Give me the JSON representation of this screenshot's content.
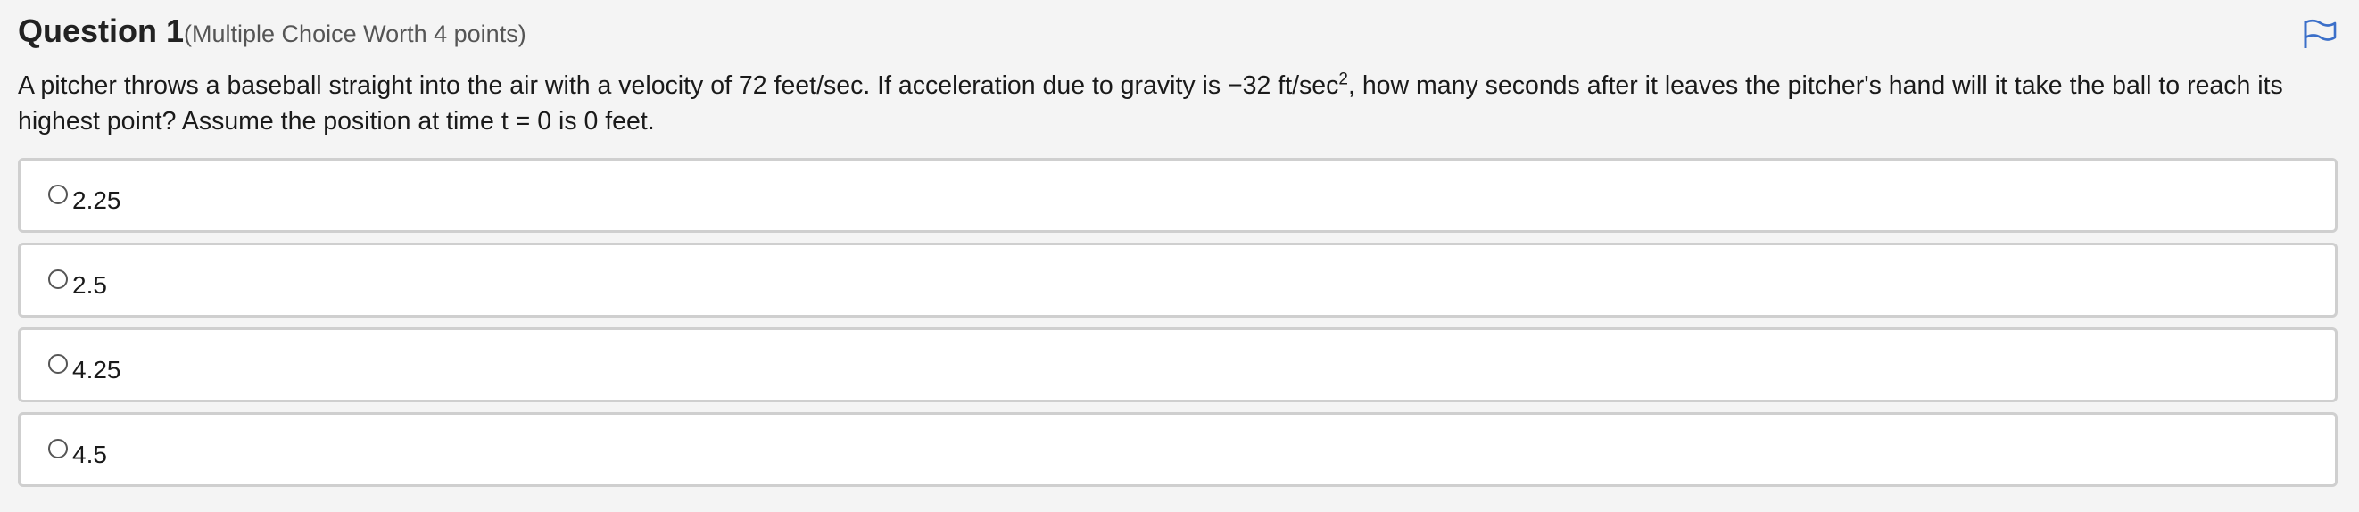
{
  "question": {
    "title": "Question 1",
    "meta": "(Multiple Choice Worth 4 points)",
    "stem_part1": "A pitcher throws a baseball straight into the air with a velocity of 72 feet/sec. If acceleration due to gravity is −32 ft/sec",
    "stem_sup": "2",
    "stem_part2": ", how many seconds after it leaves the pitcher's hand will it take the ball to reach its highest point? Assume the position at time t = 0 is 0 feet."
  },
  "choices": [
    {
      "label": "2.25"
    },
    {
      "label": "2.5"
    },
    {
      "label": "4.25"
    },
    {
      "label": "4.5"
    }
  ],
  "icons": {
    "flag": "flag-icon"
  },
  "colors": {
    "flag": "#3b6fc9",
    "background": "#f4f4f4",
    "choice_border": "#cfcfcf"
  }
}
